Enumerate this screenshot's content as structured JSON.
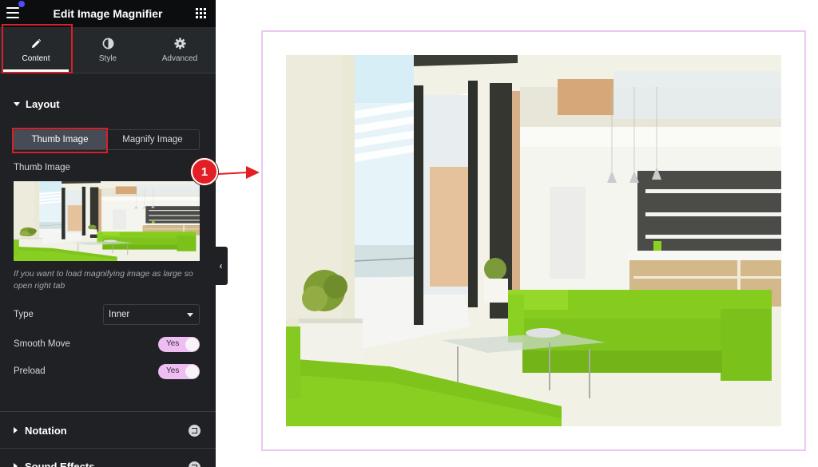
{
  "header": {
    "title": "Edit Image Magnifier",
    "menu_icon": "hamburger-icon",
    "apps_icon": "grid-icon"
  },
  "tabs": [
    {
      "label": "Content",
      "icon": "pencil-icon",
      "active": true
    },
    {
      "label": "Style",
      "icon": "half-circle-icon",
      "active": false
    },
    {
      "label": "Advanced",
      "icon": "gear-icon",
      "active": false
    }
  ],
  "layout_section": {
    "title": "Layout",
    "expanded": true,
    "image_switcher": {
      "options": [
        "Thumb Image",
        "Magnify Image"
      ],
      "selected": "Thumb Image"
    },
    "thumb_label": "Thumb Image",
    "hint": "If you want to load magnifying image as large so open right tab",
    "type": {
      "label": "Type",
      "value": "Inner"
    },
    "smooth_move": {
      "label": "Smooth Move",
      "value": "Yes",
      "on": true
    },
    "preload": {
      "label": "Preload",
      "value": "Yes",
      "on": true
    }
  },
  "sections": [
    {
      "title": "Notation",
      "expanded": false,
      "pro": true
    },
    {
      "title": "Sound Effects",
      "expanded": false,
      "pro": true
    }
  ],
  "annotation": {
    "step": "1"
  },
  "colors": {
    "panel_bg": "#1f2124",
    "header_bg": "#0c0d0e",
    "highlight_red": "#d6212b",
    "toggle_on": "#eebdf2",
    "frame_border": "#eac8f0",
    "sofa_green": "#7ed321"
  }
}
